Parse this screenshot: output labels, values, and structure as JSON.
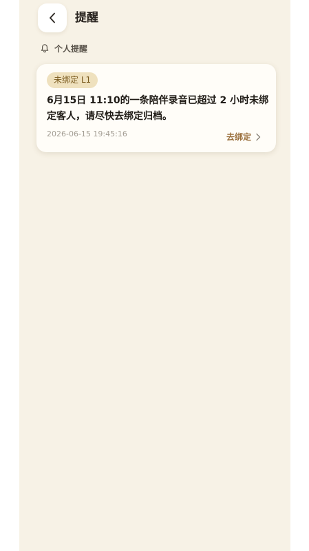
{
  "header": {
    "title": "提醒",
    "back_icon": "chevron-left-icon"
  },
  "section": {
    "label": "个人提醒",
    "icon": "bell-icon"
  },
  "reminders": [
    {
      "badge": "未绑定 L1",
      "message": "6月15日 11:10的一条陪伴录音已超过 2 小时未绑\n定客人，请尽快去绑定归档。",
      "timestamp": "2026-06-15 19:45:16",
      "action_label": "去绑定",
      "action_icon": "chevron-right-icon"
    }
  ],
  "colors": {
    "background": "#f7f2e6",
    "card": "#fffdf8",
    "badge_bg": "#efe1be",
    "badge_text": "#7a5a1e",
    "action_text": "#9a6f3c"
  }
}
